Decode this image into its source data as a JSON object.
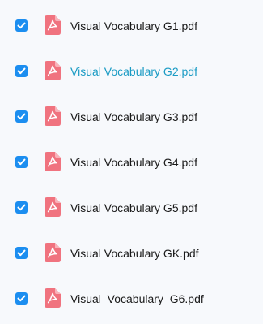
{
  "file_list": {
    "items": [
      {
        "name": "Visual Vocabulary G1.pdf",
        "checked": true,
        "highlighted": false,
        "icon": "pdf-icon"
      },
      {
        "name": "Visual Vocabulary G2.pdf",
        "checked": true,
        "highlighted": true,
        "icon": "pdf-icon"
      },
      {
        "name": "Visual Vocabulary G3.pdf",
        "checked": true,
        "highlighted": false,
        "icon": "pdf-icon"
      },
      {
        "name": "Visual Vocabulary G4.pdf",
        "checked": true,
        "highlighted": false,
        "icon": "pdf-icon"
      },
      {
        "name": "Visual Vocabulary G5.pdf",
        "checked": true,
        "highlighted": false,
        "icon": "pdf-icon"
      },
      {
        "name": "Visual Vocabulary GK.pdf",
        "checked": true,
        "highlighted": false,
        "icon": "pdf-icon"
      },
      {
        "name": "Visual_Vocabulary_G6.pdf",
        "checked": true,
        "highlighted": false,
        "icon": "pdf-icon"
      }
    ]
  },
  "colors": {
    "background": "#f7f9fc",
    "checkbox": "#1c8ef0",
    "pdf_icon": "#f0737f",
    "text": "#1a1a1a",
    "highlight_text": "#1a9bc4"
  }
}
